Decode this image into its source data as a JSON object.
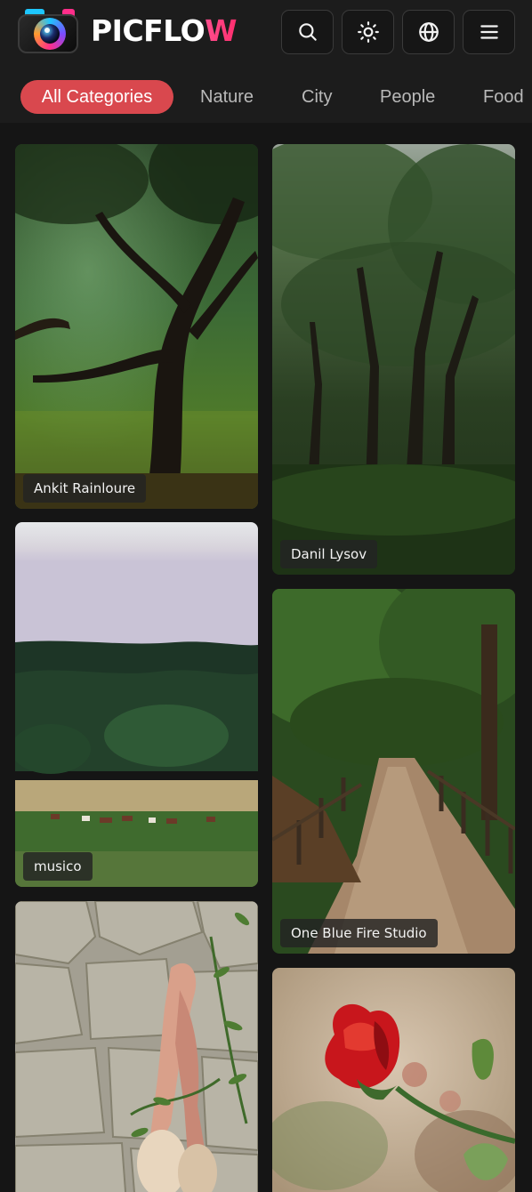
{
  "header": {
    "brand_part1": "PICFLO",
    "brand_part2": "W",
    "buttons": [
      {
        "name": "search-button",
        "icon": "search-icon"
      },
      {
        "name": "theme-toggle-button",
        "icon": "sun-icon"
      },
      {
        "name": "language-button",
        "icon": "globe-icon"
      },
      {
        "name": "menu-button",
        "icon": "menu-icon"
      }
    ]
  },
  "categories": {
    "items": [
      "All Categories",
      "Nature",
      "City",
      "People",
      "Food"
    ],
    "active": "All Categories",
    "active_color": "#d9484e"
  },
  "photos": [
    {
      "credit": "Ankit Rainloure",
      "subject": "forest"
    },
    {
      "credit": "Danil Lysov",
      "subject": "forest"
    },
    {
      "credit": "musico",
      "subject": "meadow"
    },
    {
      "credit": "One Blue Fire Studio",
      "subject": "forest path"
    },
    {
      "credit": "",
      "subject": "ballet shoes on stone wall"
    },
    {
      "credit": "",
      "subject": "red rose"
    }
  ],
  "colors": {
    "background": "#151515",
    "header": "#1c1c1c",
    "brand_accent": "#ff3f7f"
  }
}
